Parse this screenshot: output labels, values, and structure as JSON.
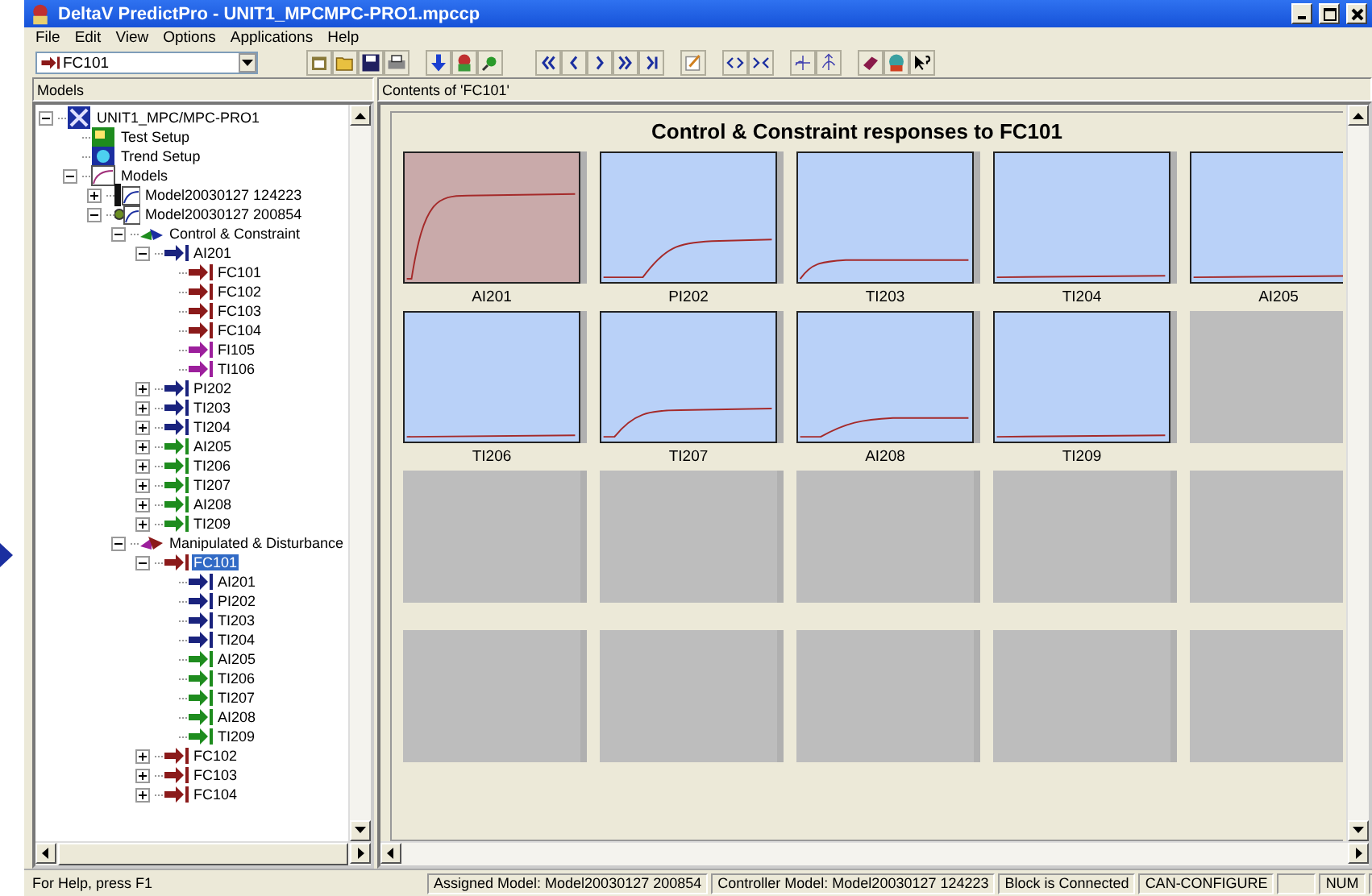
{
  "window": {
    "title": "DeltaV PredictPro - UNIT1_MPCMPC-PRO1.mpccp"
  },
  "menu": [
    "File",
    "Edit",
    "View",
    "Options",
    "Applications",
    "Help"
  ],
  "toolbar": {
    "combo_value": "FC101"
  },
  "models_header": "Models",
  "contents_header": "Contents of 'FC101'",
  "tree": [
    {
      "label": "UNIT1_MPC/MPC-PRO1",
      "kind": "project",
      "expanded": true,
      "selected": false,
      "children": [
        {
          "label": "Test Setup",
          "kind": "test",
          "selected": false
        },
        {
          "label": "Trend Setup",
          "kind": "trend",
          "selected": false
        },
        {
          "label": "Models",
          "kind": "models",
          "expanded": true,
          "selected": false,
          "children": [
            {
              "label": "Model20030127 124223",
              "kind": "controller-model",
              "expanded": false,
              "selected": false
            },
            {
              "label": "Model20030127 200854",
              "kind": "assigned-model",
              "expanded": true,
              "selected": false,
              "children": [
                {
                  "label": "Control & Constraint",
                  "kind": "cc-group",
                  "expanded": true,
                  "selected": false,
                  "children": [
                    {
                      "label": "AI201",
                      "kind": "param",
                      "color": "#1a237e",
                      "expanded": true,
                      "selected": false,
                      "children": [
                        {
                          "label": "FC101",
                          "kind": "param",
                          "color": "#8b1a1a",
                          "selected": false
                        },
                        {
                          "label": "FC102",
                          "kind": "param",
                          "color": "#8b1a1a",
                          "selected": false
                        },
                        {
                          "label": "FC103",
                          "kind": "param",
                          "color": "#8b1a1a",
                          "selected": false
                        },
                        {
                          "label": "FC104",
                          "kind": "param",
                          "color": "#8b1a1a",
                          "selected": false
                        },
                        {
                          "label": "FI105",
                          "kind": "param",
                          "color": "#9c1f9c",
                          "selected": false
                        },
                        {
                          "label": "TI106",
                          "kind": "param",
                          "color": "#9c1f9c",
                          "selected": false
                        }
                      ]
                    },
                    {
                      "label": "PI202",
                      "kind": "param",
                      "color": "#1a237e",
                      "expanded": false,
                      "selected": false
                    },
                    {
                      "label": "TI203",
                      "kind": "param",
                      "color": "#1a237e",
                      "expanded": false,
                      "selected": false
                    },
                    {
                      "label": "TI204",
                      "kind": "param",
                      "color": "#1a237e",
                      "expanded": false,
                      "selected": false
                    },
                    {
                      "label": "AI205",
                      "kind": "param",
                      "color": "#1e8c1e",
                      "expanded": false,
                      "selected": false
                    },
                    {
                      "label": "TI206",
                      "kind": "param",
                      "color": "#1e8c1e",
                      "expanded": false,
                      "selected": false
                    },
                    {
                      "label": "TI207",
                      "kind": "param",
                      "color": "#1e8c1e",
                      "expanded": false,
                      "selected": false
                    },
                    {
                      "label": "AI208",
                      "kind": "param",
                      "color": "#1e8c1e",
                      "expanded": false,
                      "selected": false
                    },
                    {
                      "label": "TI209",
                      "kind": "param",
                      "color": "#1e8c1e",
                      "expanded": false,
                      "selected": false
                    }
                  ]
                },
                {
                  "label": "Manipulated & Disturbance",
                  "kind": "md-group",
                  "expanded": true,
                  "selected": false,
                  "children": [
                    {
                      "label": "FC101",
                      "kind": "param",
                      "color": "#8b1a1a",
                      "expanded": true,
                      "selected": true,
                      "children": [
                        {
                          "label": "AI201",
                          "kind": "param",
                          "color": "#1a237e",
                          "selected": false
                        },
                        {
                          "label": "PI202",
                          "kind": "param",
                          "color": "#1a237e",
                          "selected": false
                        },
                        {
                          "label": "TI203",
                          "kind": "param",
                          "color": "#1a237e",
                          "selected": false
                        },
                        {
                          "label": "TI204",
                          "kind": "param",
                          "color": "#1a237e",
                          "selected": false
                        },
                        {
                          "label": "AI205",
                          "kind": "param",
                          "color": "#1e8c1e",
                          "selected": false
                        },
                        {
                          "label": "TI206",
                          "kind": "param",
                          "color": "#1e8c1e",
                          "selected": false
                        },
                        {
                          "label": "TI207",
                          "kind": "param",
                          "color": "#1e8c1e",
                          "selected": false
                        },
                        {
                          "label": "AI208",
                          "kind": "param",
                          "color": "#1e8c1e",
                          "selected": false
                        },
                        {
                          "label": "TI209",
                          "kind": "param",
                          "color": "#1e8c1e",
                          "selected": false
                        }
                      ]
                    },
                    {
                      "label": "FC102",
                      "kind": "param",
                      "color": "#8b1a1a",
                      "expanded": false,
                      "selected": false
                    },
                    {
                      "label": "FC103",
                      "kind": "param",
                      "color": "#8b1a1a",
                      "expanded": false,
                      "selected": false
                    },
                    {
                      "label": "FC104",
                      "kind": "param",
                      "color": "#8b1a1a",
                      "expanded": false,
                      "selected": false
                    }
                  ]
                }
              ]
            }
          ]
        }
      ]
    }
  ],
  "responses": {
    "title": "Control & Constraint responses to  FC101",
    "tiles": [
      {
        "kind": "response",
        "label": "AI201",
        "selected": true
      },
      {
        "kind": "response",
        "label": "PI202",
        "selected": false
      },
      {
        "kind": "response",
        "label": "TI203",
        "selected": false
      },
      {
        "kind": "response",
        "label": "TI204",
        "selected": false
      },
      {
        "kind": "response",
        "label": "AI205",
        "selected": false
      },
      {
        "kind": "response",
        "label": "TI206",
        "selected": false
      },
      {
        "kind": "response",
        "label": "TI207",
        "selected": false
      },
      {
        "kind": "response",
        "label": "AI208",
        "selected": false
      },
      {
        "kind": "response",
        "label": "TI209",
        "selected": false
      },
      {
        "kind": "empty"
      },
      {
        "kind": "empty"
      },
      {
        "kind": "empty"
      },
      {
        "kind": "empty"
      },
      {
        "kind": "empty"
      },
      {
        "kind": "empty"
      },
      {
        "kind": "empty"
      },
      {
        "kind": "empty"
      },
      {
        "kind": "empty"
      },
      {
        "kind": "empty"
      },
      {
        "kind": "empty"
      }
    ]
  },
  "status_bar": {
    "help": "For Help, press F1",
    "panes": [
      "Assigned Model: Model20030127 200854",
      "Controller Model: Model20030127 124223",
      "Block is Connected",
      "CAN-CONFIGURE",
      "NUM"
    ]
  }
}
